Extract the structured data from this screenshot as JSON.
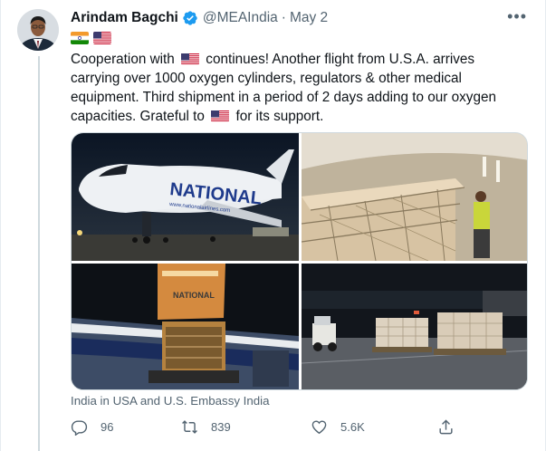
{
  "tweet": {
    "author_name": "Arindam Bagchi",
    "handle": "@MEAIndia",
    "separator": "·",
    "date": "May 2",
    "more_label": "•••",
    "flags": [
      "india-flag",
      "usa-flag"
    ],
    "text": {
      "part1": "Cooperation with",
      "part2": "continues! Another flight from U.S.A. arrives carrying over 1000 oxygen cylinders, regulators & other medical equipment. Third shipment in a period of 2 days adding to our oxygen capacities. Grateful to",
      "part3": "for its support."
    },
    "media": {
      "images": [
        "airplane-photo",
        "cargo-hold-photo",
        "cargo-door-photo",
        "tarmac-pallets-photo"
      ],
      "aircraft_lettering": "NATIONAL",
      "aircraft_web_lettering": "www.nationalairlines.com",
      "door_lettering": "NATIONAL"
    },
    "credit": "India in USA and U.S. Embassy India",
    "actions": {
      "replies": "96",
      "retweets": "839",
      "likes": "5.6K"
    }
  },
  "colors": {
    "text_primary": "#0f1419",
    "text_secondary": "#536471",
    "verified_blue": "#1d9bf0",
    "border": "#cfd9de"
  }
}
